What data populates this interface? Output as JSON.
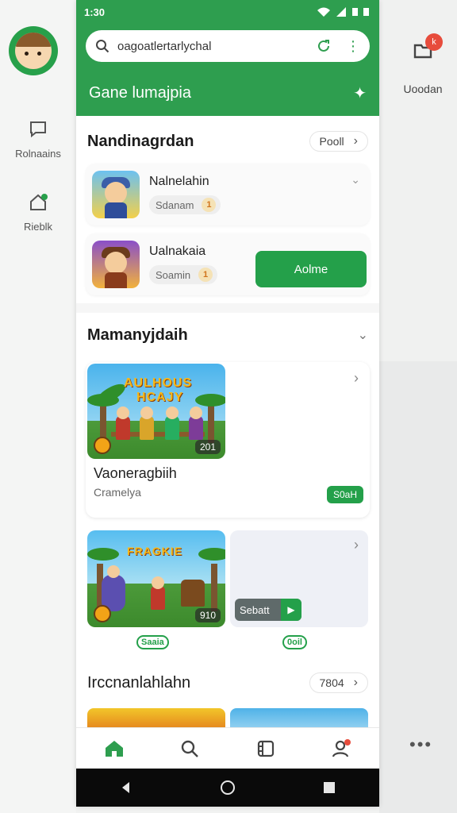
{
  "status": {
    "time": "1:30"
  },
  "background": {
    "left_nav": [
      {
        "label": "Rolnaains",
        "icon": "chat-bubble-icon"
      },
      {
        "label": "Rieblk",
        "icon": "home-badge-icon"
      }
    ],
    "right_item": {
      "label": "Uoodan",
      "badge": "k",
      "icon": "folder-icon"
    }
  },
  "search": {
    "value": "oagoatlertarlychal"
  },
  "header": {
    "title": "Gane lumajpia"
  },
  "section1": {
    "title": "Nandinagrdan",
    "action": "Pooll",
    "items": [
      {
        "title": "Nalnelahin",
        "chip": "Sdanam",
        "chip_num": "1"
      },
      {
        "title": "Ualnakaia",
        "chip": "Soamin",
        "chip_num": "1",
        "button": "Aolme"
      }
    ]
  },
  "section2": {
    "title": "Mamanyjdaih",
    "featured": {
      "banner_text_1": "AULHOUS",
      "banner_text_2": "HCAJY",
      "badge": "201",
      "title": "Vaoneragbiih",
      "subtitle": "Cramelya",
      "tag": "S0aH"
    },
    "tile_badge": "910",
    "tile_banner_text": "FRAGKIE",
    "tile_button": "Sebatt",
    "label_left": "Saaia",
    "label_right": "0oil"
  },
  "section3": {
    "title": "Irccnanlahlahn",
    "action": "7804"
  },
  "tabs": [
    "home-icon",
    "search-icon",
    "library-icon",
    "profile-icon"
  ],
  "colors": {
    "accent": "#2e9e4f",
    "button": "#24a04a",
    "badge": "#e74c3c"
  }
}
